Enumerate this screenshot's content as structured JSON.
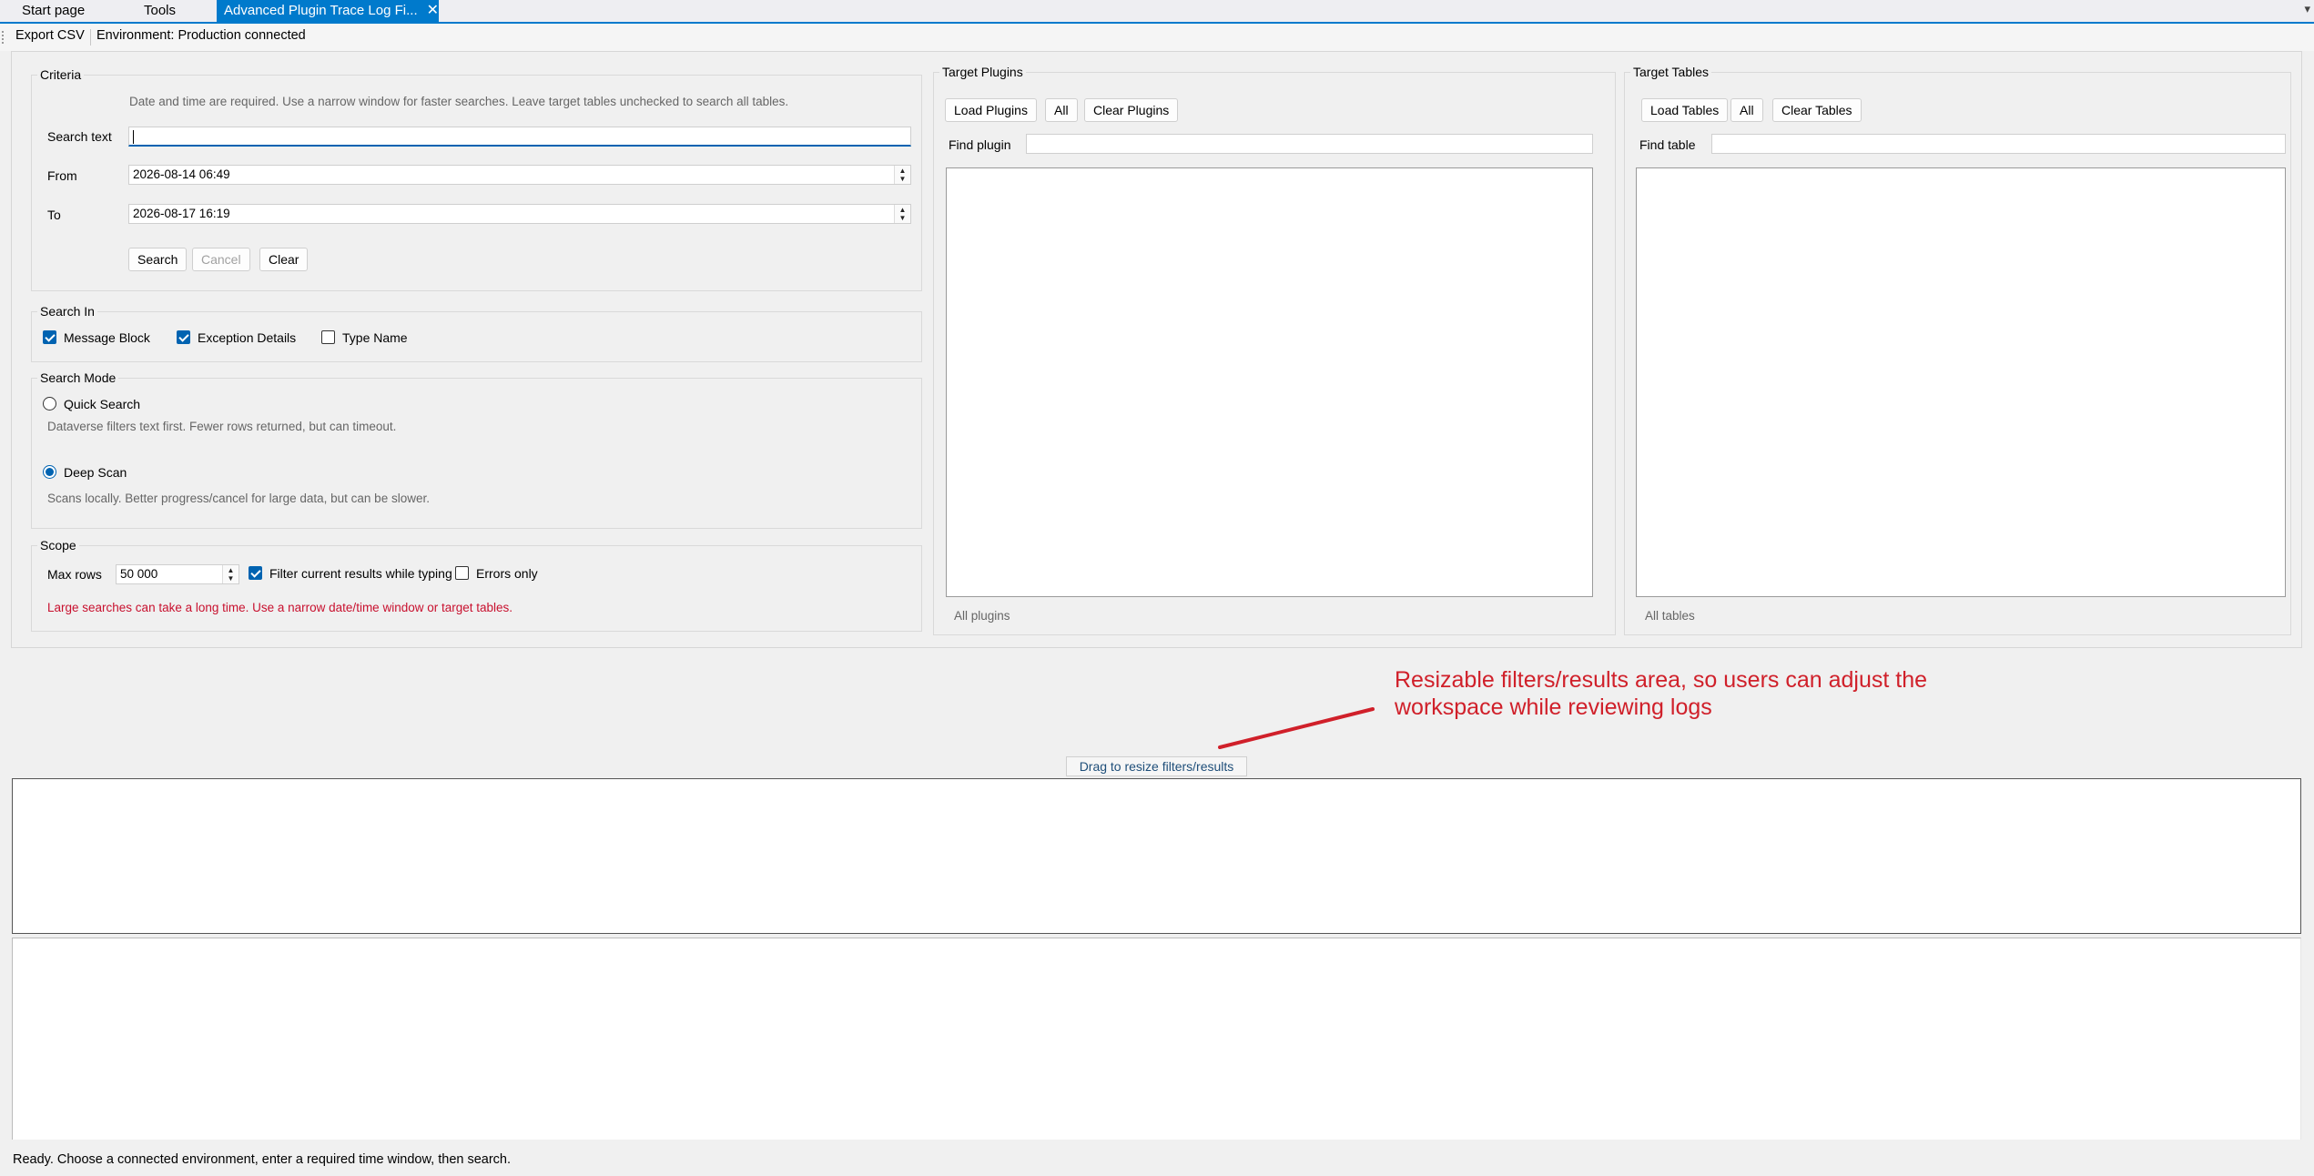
{
  "tabs": [
    {
      "label": "Start page"
    },
    {
      "label": "Tools"
    },
    {
      "label": "Advanced Plugin Trace Log Fi...",
      "close": "✕"
    }
  ],
  "toolbar": {
    "export_label": "Export CSV",
    "environment_label": "Environment: Production connected"
  },
  "criteria": {
    "legend": "Criteria",
    "hint": "Date and time are required. Use a narrow window for faster searches. Leave target tables unchecked to search all tables.",
    "search_text_label": "Search text",
    "search_text_value": "",
    "from_label": "From",
    "from_value": "2026-08-14 06:49",
    "to_label": "To",
    "to_value": "2026-08-17 16:19",
    "search_button": "Search",
    "cancel_button": "Cancel",
    "clear_button": "Clear"
  },
  "search_in": {
    "legend": "Search In",
    "options": [
      {
        "label": "Message Block",
        "checked": true
      },
      {
        "label": "Exception Details",
        "checked": true
      },
      {
        "label": "Type Name",
        "checked": false
      }
    ]
  },
  "search_mode": {
    "legend": "Search Mode",
    "quick_label": "Quick Search",
    "quick_desc": "Dataverse filters text first. Fewer rows returned, but can timeout.",
    "deep_label": "Deep Scan",
    "deep_desc": "Scans locally. Better progress/cancel for large data, but can be slower.",
    "selected": "Deep Scan"
  },
  "scope": {
    "legend": "Scope",
    "max_rows_label": "Max rows",
    "max_rows_value": "50 000",
    "filter_typing_label": "Filter current results while typing",
    "filter_typing_checked": true,
    "errors_only_label": "Errors only",
    "errors_only_checked": false,
    "warning": "Large searches can take a long time. Use a narrow date/time window or target tables."
  },
  "target_plugins": {
    "legend": "Target Plugins",
    "load_button": "Load Plugins",
    "all_button": "All",
    "clear_button": "Clear Plugins",
    "find_label": "Find plugin",
    "find_value": "",
    "footer": "All plugins"
  },
  "target_tables": {
    "legend": "Target Tables",
    "load_button": "Load Tables",
    "all_button": "All",
    "clear_button": "Clear Tables",
    "find_label": "Find table",
    "find_value": "",
    "footer": "All tables"
  },
  "splitter": {
    "label": "Drag to resize filters/results"
  },
  "annotation": {
    "line1": "Resizable filters/results area, so users can adjust the",
    "line2": "workspace while reviewing logs",
    "color": "#d0202a"
  },
  "status": {
    "text": "Ready. Choose a connected environment, enter a required time window, then search."
  },
  "colors": {
    "accent": "#007acc",
    "check": "#0063b1",
    "warning": "#c8102e"
  }
}
